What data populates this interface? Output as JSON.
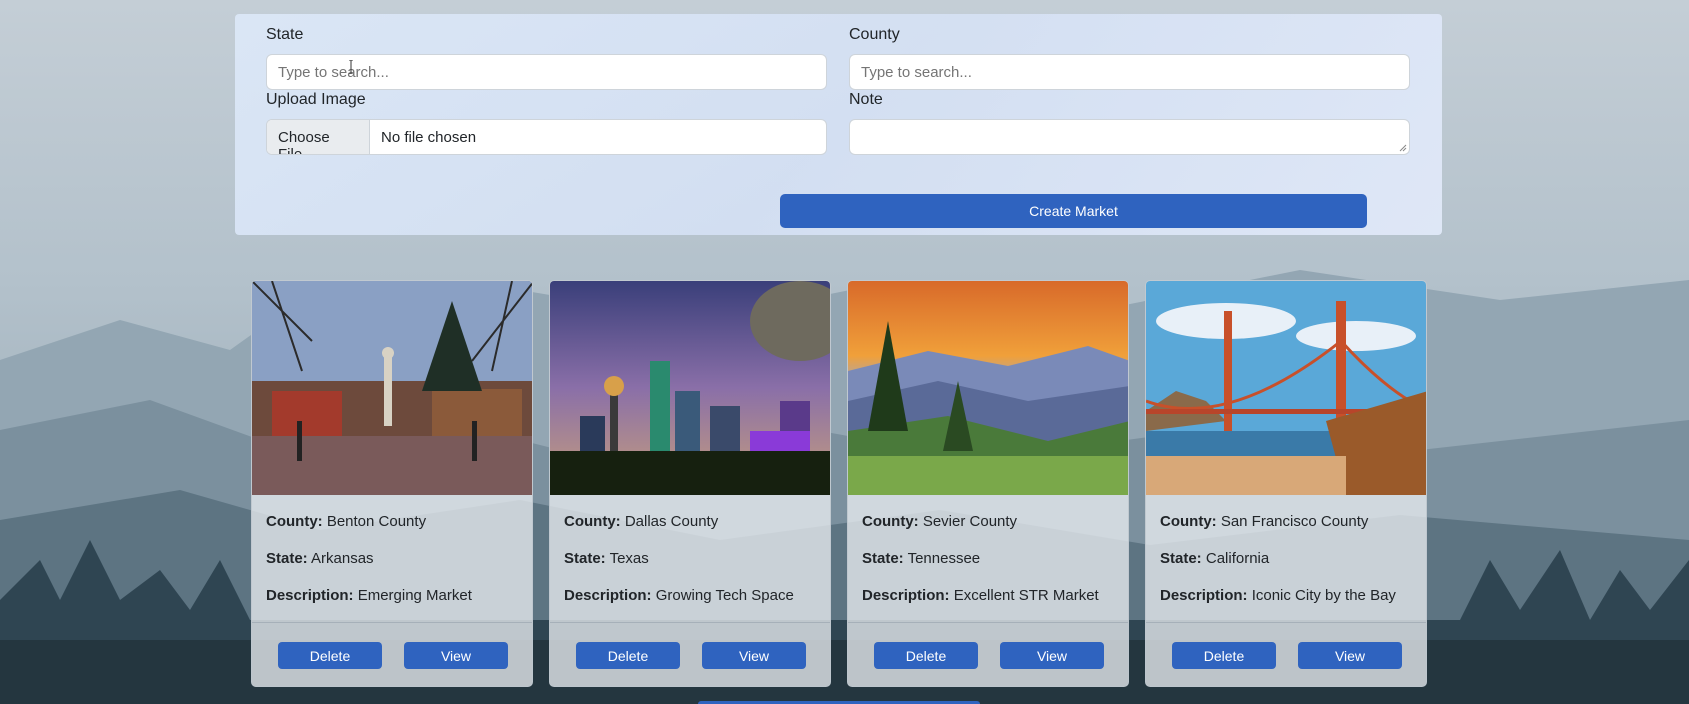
{
  "form": {
    "state_label": "State",
    "state_placeholder": "Type to search...",
    "county_label": "County",
    "county_placeholder": "Type to search...",
    "upload_label": "Upload Image",
    "file_button": "Choose File",
    "file_status": "No file chosen",
    "note_label": "Note",
    "note_value": "",
    "create_button": "Create Market"
  },
  "cards": [
    {
      "image": "town-square-photo",
      "county_label": "County:",
      "county": "Benton County",
      "state_label": "State:",
      "state": "Arkansas",
      "description_label": "Description:",
      "description": "Emerging Market",
      "delete_label": "Delete",
      "view_label": "View"
    },
    {
      "image": "city-skyline-photo",
      "county_label": "County:",
      "county": "Dallas County",
      "state_label": "State:",
      "state": "Texas",
      "description_label": "Description:",
      "description": "Growing Tech Space",
      "delete_label": "Delete",
      "view_label": "View"
    },
    {
      "image": "mountain-sunset-photo",
      "county_label": "County:",
      "county": "Sevier County",
      "state_label": "State:",
      "state": "Tennessee",
      "description_label": "Description:",
      "description": "Excellent STR Market",
      "delete_label": "Delete",
      "view_label": "View"
    },
    {
      "image": "golden-gate-bridge-photo",
      "county_label": "County:",
      "county": "San Francisco County",
      "state_label": "State:",
      "state": "California",
      "description_label": "Description:",
      "description": "Iconic City by the Bay",
      "delete_label": "Delete",
      "view_label": "View"
    }
  ],
  "colors": {
    "primary": "#2f63bf",
    "panel": "#dce8f8"
  }
}
